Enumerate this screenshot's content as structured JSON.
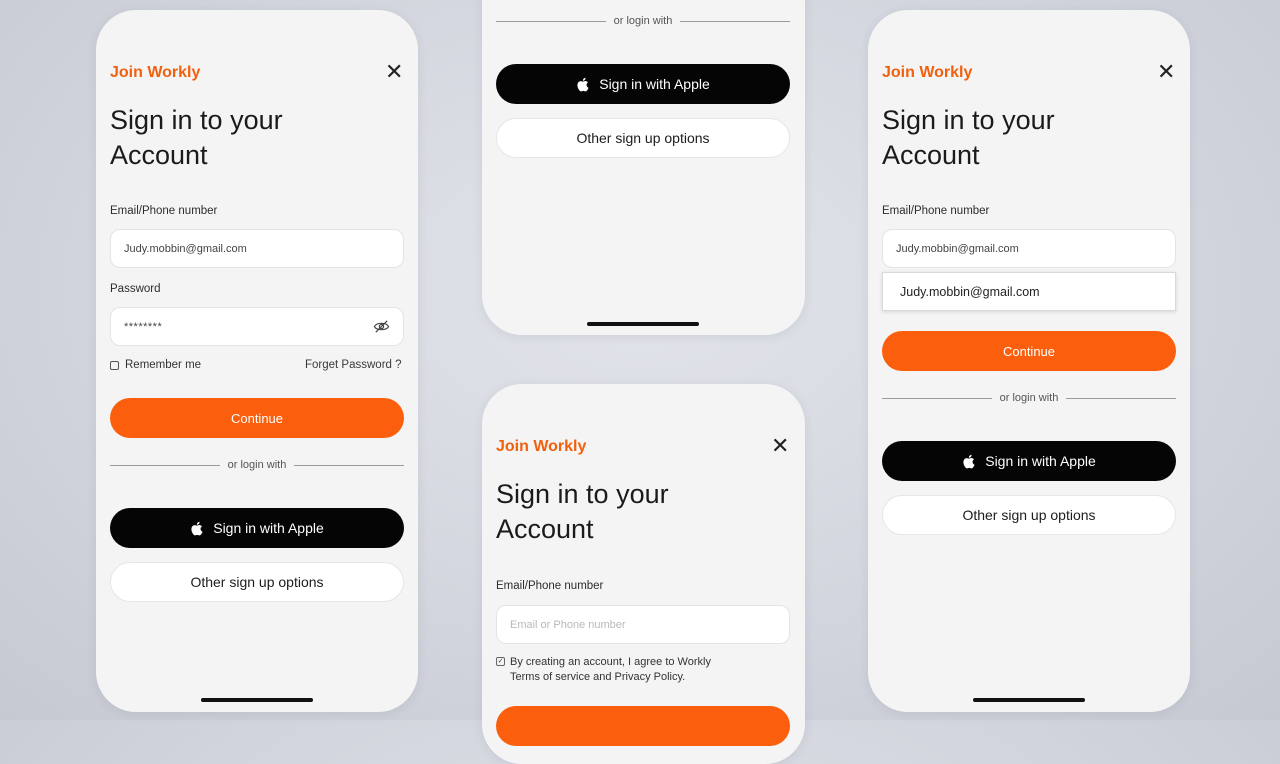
{
  "brand": "Join Workly",
  "heading": "Sign in to your\nAccount",
  "close_glyph": "✕",
  "email_label": "Email/Phone number",
  "password_label": "Password",
  "continue_label": "Continue",
  "divider_text": "or login with",
  "apple_label": "Sign in with Apple",
  "other_label": "Other sign up options",
  "screen1": {
    "email_value": "Judy.mobbin@gmail.com",
    "password_value": "********",
    "remember_label": "Remember me",
    "forgot_label": "Forget Password ?"
  },
  "screen3": {
    "email_placeholder": "Email or Phone number",
    "terms_text": "By creating an account, I agree to Workly\nTerms of service and Privacy Policy.",
    "terms_checked": true
  },
  "screen4": {
    "email_value": "Judy.mobbin@gmail.com",
    "suggestion": "Judy.mobbin@gmail.com"
  },
  "icons": [
    "close-icon",
    "eye-off-icon",
    "apple-icon",
    "checkbox-icon"
  ],
  "colors": {
    "accent": "#fb5f0d",
    "brand_text": "#f2600c",
    "dark_button": "#050505",
    "card_bg": "#f4f4f5"
  }
}
